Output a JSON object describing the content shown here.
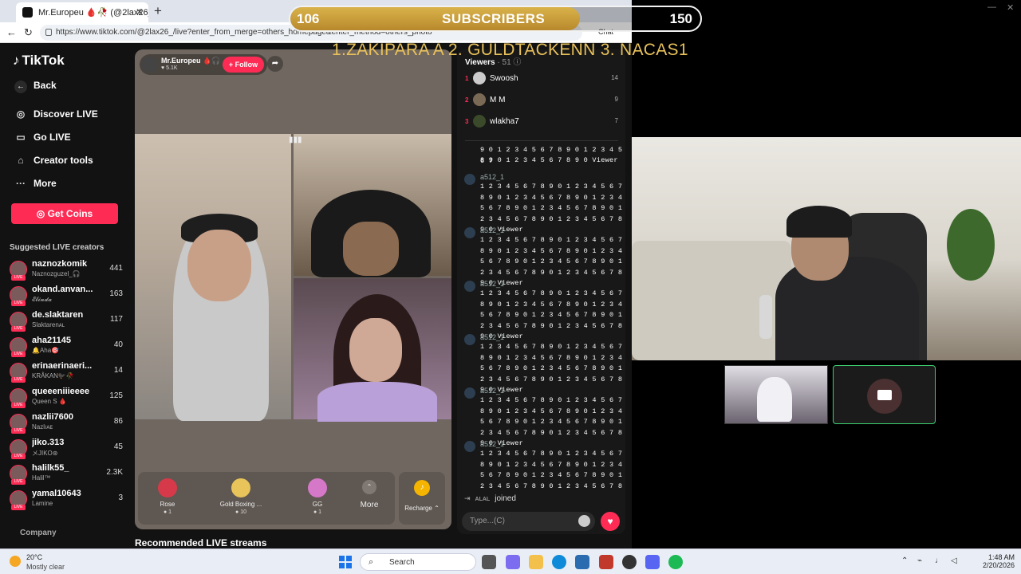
{
  "browser": {
    "tab_title": "Mr.Europeu 🩸🥀 (@2lax26_) is L",
    "url": "https://www.tiktok.com/@2lax26_/live?enter_from_merge=others_homepage&enter_method=others_photo",
    "chat_label": "Chat"
  },
  "sidebar": {
    "logo": "TikTok",
    "back": "Back",
    "items": [
      {
        "label": "Discover LIVE",
        "icon": "globe-icon"
      },
      {
        "label": "Go LIVE",
        "icon": "camera-icon"
      },
      {
        "label": "Creator tools",
        "icon": "home-icon"
      },
      {
        "label": "More",
        "icon": "more-icon"
      }
    ],
    "get_coins": "Get Coins",
    "suggested_title": "Suggested LIVE creators",
    "creators": [
      {
        "name": "naznozkomik",
        "sub": "Naznozguzel_🎧",
        "count": "441"
      },
      {
        "name": "okand.anvan...",
        "sub": "𝓔𝓵𝓲𝓷𝓭𝓪",
        "count": "163"
      },
      {
        "name": "de.slaktaren",
        "sub": "Slaktarenᴀʟ",
        "count": "117"
      },
      {
        "name": "aha21145",
        "sub": "🔔Aha🎯",
        "count": "40"
      },
      {
        "name": "erinaerinaeri...",
        "sub": "KRÅKAN🐦‍⬛🥀",
        "count": "14"
      },
      {
        "name": "queeeniiieeee",
        "sub": "Queen S 🩸",
        "count": "125"
      },
      {
        "name": "nazlii7600",
        "sub": "Nazlıᴀᴇ",
        "count": "86"
      },
      {
        "name": "jiko.313",
        "sub": "メJIKO⊛",
        "count": "45"
      },
      {
        "name": "halilk55_",
        "sub": "Halil™",
        "count": "2.3K"
      },
      {
        "name": "yamal10643",
        "sub": "Lamine",
        "count": "3"
      }
    ],
    "company": "Company"
  },
  "stream": {
    "host_name": "Mr.Europeu 🩸🎧",
    "host_likes": "♥ 5.1K",
    "follow": "+ Follow",
    "gifts": [
      {
        "name": "Rose",
        "price": "1"
      },
      {
        "name": "Gold Boxing ...",
        "price": "10"
      },
      {
        "name": "GG",
        "price": "1"
      }
    ],
    "more": "More",
    "recharge": "Recharge ⌃",
    "recommended": "Recommended LIVE streams"
  },
  "chat": {
    "viewers_label": "Viewers",
    "viewers_count": "· 51 ⓘ",
    "top_viewers": [
      {
        "rank": "1",
        "name": "Swoosh",
        "score": "14"
      },
      {
        "rank": "2",
        "name": "M M",
        "score": "9"
      },
      {
        "rank": "3",
        "name": "wlakha7",
        "score": "7"
      }
    ],
    "partial_line1": "9 0 1 2 3 4 5 6 7 8 9 0 1 2 3 4 5 6 7",
    "partial_line2": "8 9 0 1 2 3 4 5 6 7 8 9 0 Viewer",
    "messages": [
      {
        "user": "a512_1",
        "body": "1 2 3 4 5 6 7 8 9 0 1 2 3 4 5 6 7 8 9 0 1 2 3 4 5 6 7 8 9 0 1 2 3 4 5 6 7 8 9 0 1 2 3 4 5 6 7 8 9 0 1 2 3 4 5 6 7 8 9 0 1 2 3 4 5 6 7 8 9 0 Viewer"
      },
      {
        "user": "a512_1",
        "body": "1 2 3 4 5 6 7 8 9 0 1 2 3 4 5 6 7 8 9 0 1 2 3 4 5 6 7 8 9 0 1 2 3 4 5 6 7 8 9 0 1 2 3 4 5 6 7 8 9 0 1 2 3 4 5 6 7 8 9 0 1 2 3 4 5 6 7 8 9 0 Viewer"
      },
      {
        "user": "a512_1",
        "body": "1 2 3 4 5 6 7 8 9 0 1 2 3 4 5 6 7 8 9 0 1 2 3 4 5 6 7 8 9 0 1 2 3 4 5 6 7 8 9 0 1 2 3 4 5 6 7 8 9 0 1 2 3 4 5 6 7 8 9 0 1 2 3 4 5 6 7 8 9 0 Viewer"
      },
      {
        "user": "a512_1",
        "body": "1 2 3 4 5 6 7 8 9 0 1 2 3 4 5 6 7 8 9 0 1 2 3 4 5 6 7 8 9 0 1 2 3 4 5 6 7 8 9 0 1 2 3 4 5 6 7 8 9 0 1 2 3 4 5 6 7 8 9 0 1 2 3 4 5 6 7 8 9 0 Viewer"
      },
      {
        "user": "a512_1",
        "body": "1 2 3 4 5 6 7 8 9 0 1 2 3 4 5 6 7 8 9 0 1 2 3 4 5 6 7 8 9 0 1 2 3 4 5 6 7 8 9 0 1 2 3 4 5 6 7 8 9 0 1 2 3 4 5 6 7 8 9 0 1 2 3 4 5 6 7 8 9 0 Viewer"
      },
      {
        "user": "a512_1",
        "body": "1 2 3 4 5 6 7 8 9 0 1 2 3 4 5 6 7 8 9 0 1 2 3 4 5 6 7 8 9 0 1 2 3 4 5 6 7 8 9 0 1 2 3 4 5 6 7 8 9 0 1 2 3 4 5 6 7 8 9 0 1 2 3 4 5 6 7 8 9 0 Viewer"
      }
    ],
    "joined_name": "ALAL",
    "joined_text": "joined",
    "input_placeholder": "Type...(C)"
  },
  "overlay": {
    "current": "106",
    "label": "SUBSCRIBERS",
    "goal": "150",
    "progress": 0.7067,
    "top_donors": "1.ZAKIPARA A 2. GULDTACKENN  3.  NACAS1"
  },
  "taskbar": {
    "temp": "20°C",
    "weather": "Mostly clear",
    "search": "Search",
    "time": "1:48 AM",
    "date": "2/20/2026"
  },
  "colors": {
    "accent": "#fe2c55",
    "gold": "#e8c15a",
    "cam_active_border": "#3cd070"
  }
}
